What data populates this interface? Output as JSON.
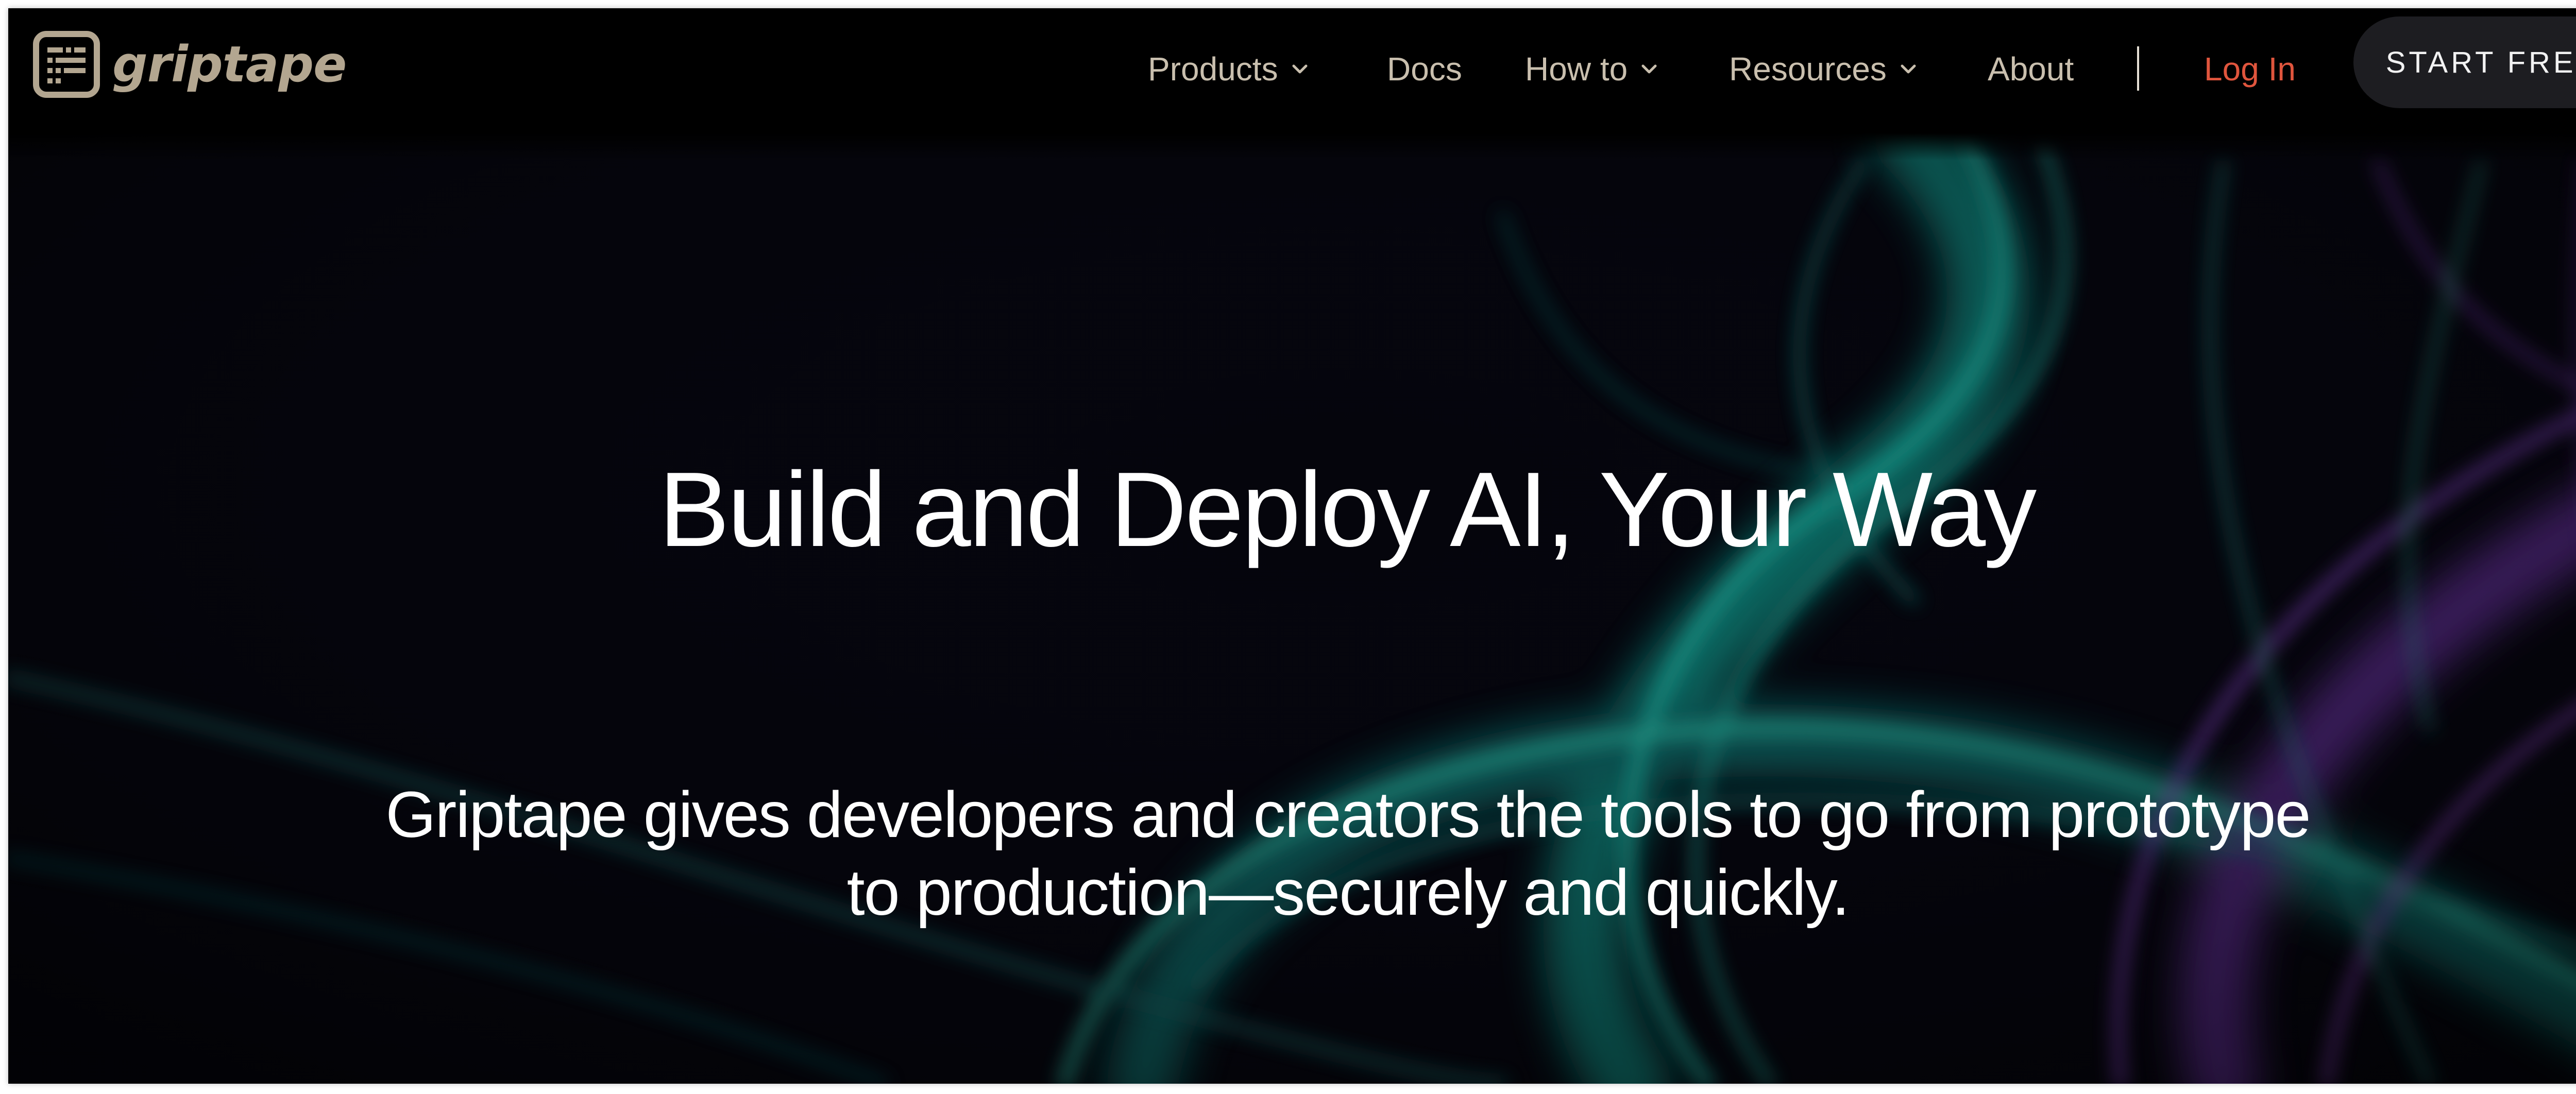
{
  "brand": {
    "name": "griptape",
    "logo_icon": "keyboard-grid-icon",
    "logo_color": "#b3a690"
  },
  "nav": {
    "products": "Products",
    "docs": "Docs",
    "how_to": "How to",
    "resources": "Resources",
    "about": "About",
    "login": "Log In",
    "start_free": "START FREE",
    "dropdown_icon": "chevron-down-icon"
  },
  "hero": {
    "title": "Build and Deploy AI, Your Way",
    "subtitle": "Griptape gives developers and creators the tools to go from prototype to production—securely and quickly."
  },
  "colors": {
    "background": "#05050c",
    "nav_text": "#c9bfae",
    "login_accent": "#e0553d",
    "button_bg": "#1d1d21",
    "ribbon_teal": "#1fb3a0",
    "ribbon_purple": "#8a3fc0"
  }
}
